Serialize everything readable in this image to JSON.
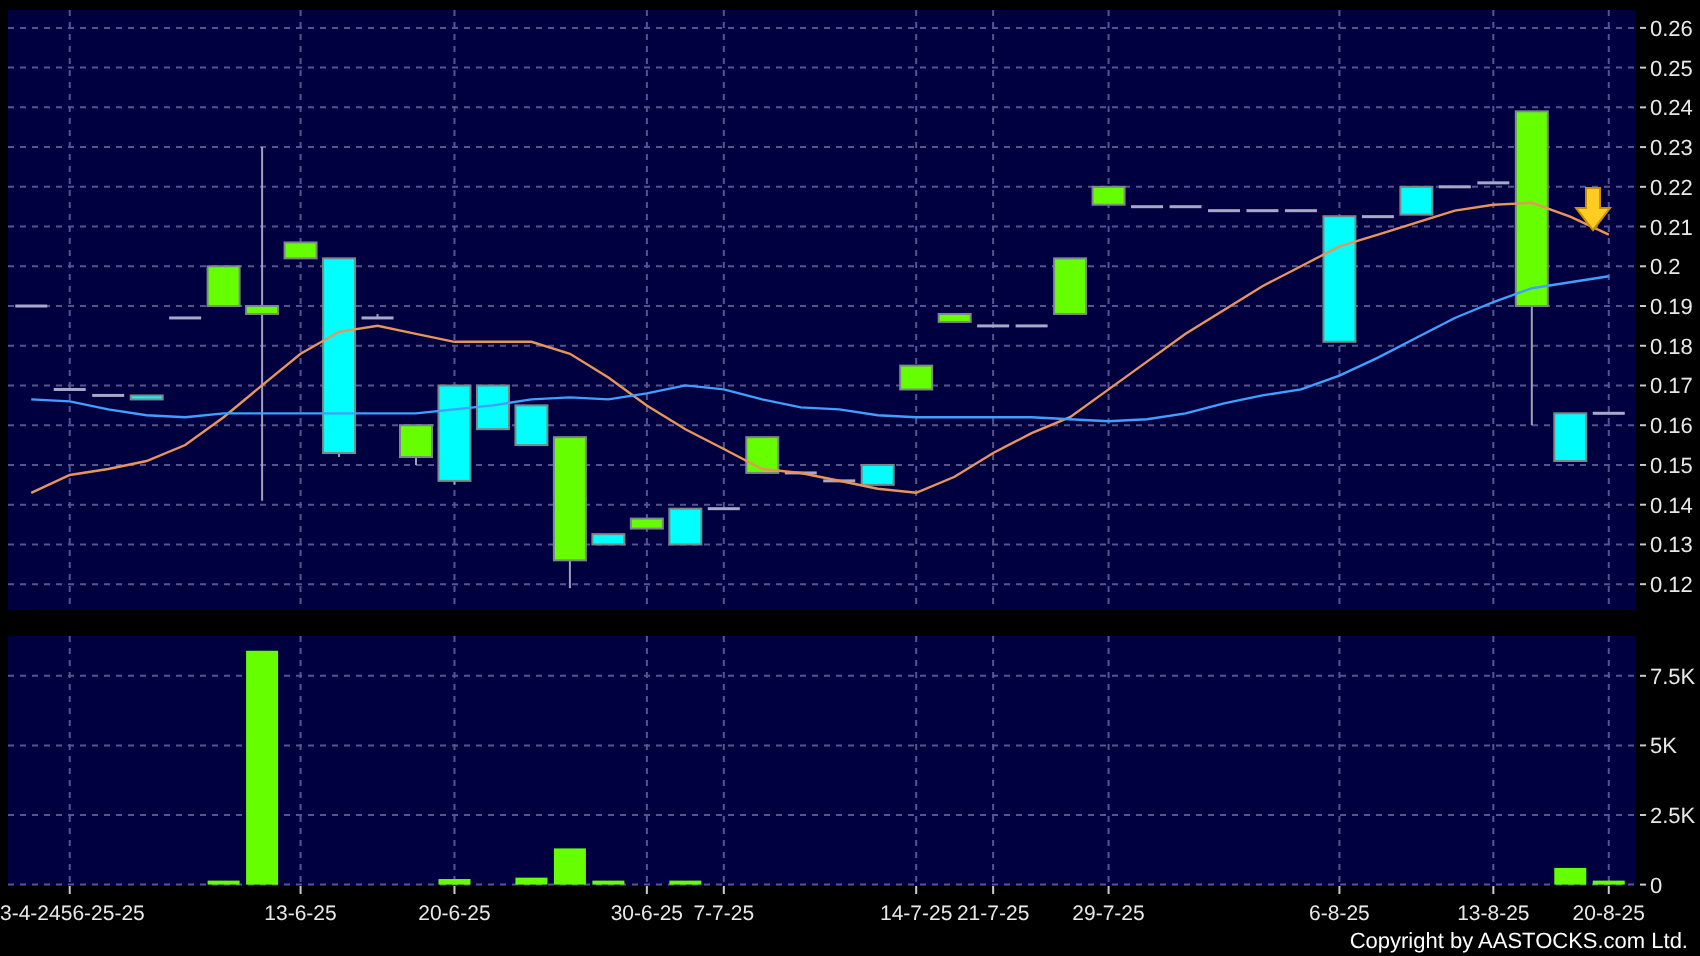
{
  "price_chart": {
    "chart_data": {
      "type": "line",
      "grid": true,
      "ylim": [
        0.1135,
        0.2645
      ],
      "yticks": [
        0.12,
        0.13,
        0.14,
        0.15,
        0.16,
        0.17,
        0.18,
        0.19,
        0.2,
        0.21,
        0.22,
        0.23,
        0.24,
        0.25,
        0.26
      ],
      "series": [
        {
          "color": "#e8955a",
          "values": [
            0.143,
            0.1475,
            0.149,
            0.151,
            0.155,
            0.162,
            0.17,
            0.178,
            0.1835,
            0.185,
            0.183,
            0.181,
            0.181,
            0.181,
            0.178,
            0.172,
            0.165,
            0.159,
            0.154,
            0.149,
            0.148,
            0.146,
            0.144,
            0.143,
            0.147,
            0.153,
            0.158,
            0.162,
            0.169,
            0.176,
            0.183,
            0.189,
            0.195,
            0.2,
            0.205,
            0.208,
            0.211,
            0.214,
            0.2155,
            0.216,
            0.2125,
            0.208
          ]
        },
        {
          "color": "#3fa0ff",
          "values": [
            0.1665,
            0.166,
            0.164,
            0.1625,
            0.162,
            0.163,
            0.163,
            0.163,
            0.163,
            0.163,
            0.163,
            0.164,
            0.165,
            0.1665,
            0.167,
            0.1665,
            0.168,
            0.17,
            0.169,
            0.1665,
            0.1645,
            0.164,
            0.1625,
            0.162,
            0.162,
            0.162,
            0.162,
            0.1615,
            0.161,
            0.1615,
            0.163,
            0.1655,
            0.1675,
            0.169,
            0.1725,
            0.177,
            0.182,
            0.187,
            0.191,
            0.1945,
            0.196,
            0.1975
          ]
        }
      ]
    },
    "candles": [
      {
        "color": "#a8a8c8"
      },
      {
        "color": "#a8a8c8"
      },
      {
        "color": "#a8a8c8"
      },
      {
        "color": "#00ffff"
      },
      {
        "color": "#a8a8c8"
      },
      {
        "color": "#66ff00"
      },
      {
        "color": "#66ff00"
      },
      {
        "color": "#66ff00"
      },
      {
        "color": "#00ffff"
      },
      {
        "color": "#a8a8c8"
      },
      {
        "color": "#66ff00"
      },
      {
        "color": "#00ffff"
      },
      {
        "color": "#00ffff"
      },
      {
        "color": "#00ffff"
      },
      {
        "color": "#66ff00"
      },
      {
        "color": "#00ffff"
      },
      {
        "color": "#66ff00"
      },
      {
        "color": "#00ffff"
      },
      {
        "color": "#a8a8c8"
      },
      {
        "color": "#66ff00"
      },
      {
        "color": "#a8a8c8"
      },
      {
        "color": "#a8a8c8"
      },
      {
        "color": "#00ffff"
      },
      {
        "color": "#66ff00"
      },
      {
        "color": "#66ff00"
      },
      {
        "color": "#a8a8c8"
      },
      {
        "color": "#a8a8c8"
      },
      {
        "color": "#66ff00"
      },
      {
        "color": "#66ff00"
      },
      {
        "color": "#a8a8c8"
      },
      {
        "color": "#a8a8c8"
      },
      {
        "color": "#a8a8c8"
      },
      {
        "color": "#a8a8c8"
      },
      {
        "color": "#a8a8c8"
      },
      {
        "color": "#00ffff"
      },
      {
        "color": "#a8a8c8"
      },
      {
        "color": "#00ffff"
      },
      {
        "color": "#a8a8c8"
      },
      {
        "color": "#a8a8c8"
      },
      {
        "color": "#66ff00"
      },
      {
        "color": "#00ffff"
      },
      {
        "color": "#a8a8c8"
      }
    ]
  },
  "volume_chart": {
    "chart_data": {
      "type": "bar",
      "grid": true,
      "categories": [
        null,
        "3-4-2456-25-25",
        null,
        null,
        null,
        null,
        null,
        "13-6-25",
        null,
        null,
        null,
        "20-6-25",
        null,
        null,
        null,
        null,
        "30-6-25",
        null,
        "7-7-25",
        null,
        null,
        null,
        null,
        "14-7-25",
        null,
        "21-7-25",
        null,
        null,
        "29-7-25",
        null,
        null,
        null,
        null,
        null,
        "6-8-25",
        null,
        null,
        null,
        "13-8-25",
        null,
        null,
        "20-8-25"
      ],
      "ylim": [
        -50,
        8930
      ],
      "yticks": [
        {
          "value": 0,
          "label": "0"
        },
        {
          "value": 2500,
          "label": "2.5K"
        },
        {
          "value": 5000,
          "label": "5K"
        },
        {
          "value": 7500,
          "label": "7.5K"
        }
      ],
      "series": [
        {
          "color": "#66ff00",
          "values": [
            0,
            0,
            0,
            0,
            0,
            70,
            8400,
            0,
            0,
            0,
            0,
            200,
            0,
            250,
            1300,
            70,
            0,
            70,
            0,
            0,
            0,
            0,
            0,
            0,
            0,
            0,
            0,
            0,
            0,
            0,
            0,
            0,
            0,
            0,
            0,
            0,
            0,
            0,
            0,
            0,
            600,
            70
          ]
        }
      ]
    }
  },
  "copyright": "Copyright by AASTOCKS.com Ltd."
}
